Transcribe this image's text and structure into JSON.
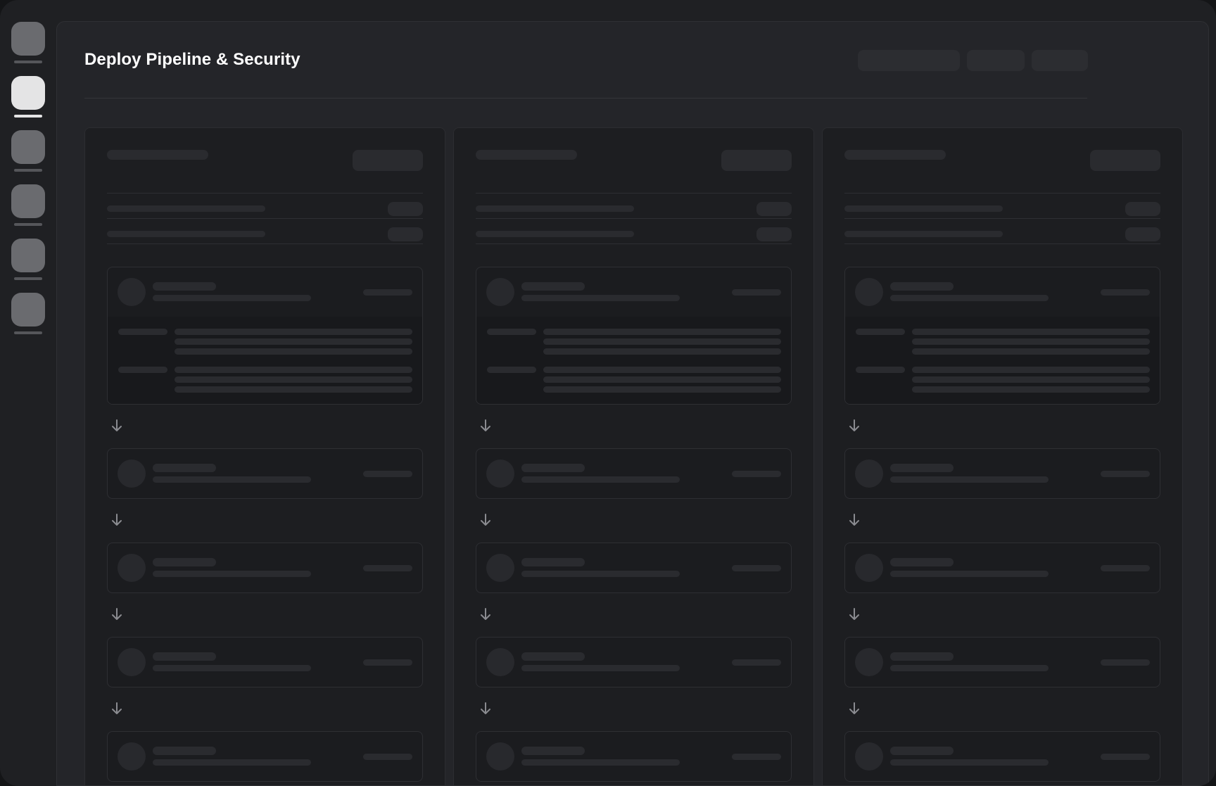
{
  "page": {
    "title": "Deploy Pipeline & Security"
  },
  "sidebar": {
    "items": [
      {
        "name": "nav-item-1",
        "active": false
      },
      {
        "name": "nav-item-2",
        "active": true
      },
      {
        "name": "nav-item-3",
        "active": false
      },
      {
        "name": "nav-item-4",
        "active": false
      },
      {
        "name": "nav-item-5",
        "active": false
      },
      {
        "name": "nav-item-6",
        "active": false
      }
    ]
  },
  "header": {
    "actions": [
      {
        "name": "header-action-1"
      },
      {
        "name": "header-action-2"
      },
      {
        "name": "header-action-3"
      }
    ]
  },
  "columns": [
    {
      "name": "pipeline-column-1",
      "stages": 5
    },
    {
      "name": "pipeline-column-2",
      "stages": 5
    },
    {
      "name": "pipeline-column-3",
      "stages": 5
    }
  ],
  "icons": {
    "flow": "arrow-down-icon"
  },
  "colors": {
    "background": "#1f2023",
    "panel": "#242529",
    "column": "#1d1e21",
    "skeleton": "#2a2b2f",
    "accent_active": "#e4e4e5",
    "arrow": "#8a8b90"
  }
}
